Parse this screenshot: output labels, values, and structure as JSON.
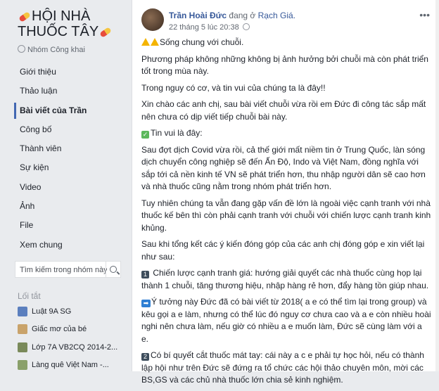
{
  "group": {
    "title": "HỘI NHÀ THUỐC TÂY",
    "privacy": "Nhóm Công khai"
  },
  "nav": [
    {
      "label": "Giới thiệu"
    },
    {
      "label": "Thảo luận"
    },
    {
      "label": "Bài viết của Trần"
    },
    {
      "label": "Công bố"
    },
    {
      "label": "Thành viên"
    },
    {
      "label": "Sự kiện"
    },
    {
      "label": "Video"
    },
    {
      "label": "Ảnh"
    },
    {
      "label": "File"
    },
    {
      "label": "Xem chung"
    }
  ],
  "search": {
    "placeholder": "Tìm kiếm trong nhóm này"
  },
  "shortcuts": {
    "title": "Lối tắt",
    "items": [
      {
        "label": "Luật 9A SG",
        "color": "#5b7fbe"
      },
      {
        "label": "Giấc mơ của bé",
        "color": "#c9a36b"
      },
      {
        "label": "Lớp 7A VB2CQ 2014-2...",
        "color": "#7a8a5a"
      },
      {
        "label": "Làng quê Việt Nam -...",
        "color": "#8aa06a"
      }
    ]
  },
  "post": {
    "author": "Trần Hoài Đức",
    "location_prefix": "đang ở",
    "location": "Rạch Giá.",
    "time": "22 tháng 5 lúc 20:38",
    "more": "•••",
    "p1": "Sống chung với chuỗi.",
    "p2": "Phương pháp không những không bị ảnh hưởng bởi chuỗi mà còn phát triển tốt trong mùa này.",
    "p3": "Trong nguy có cơ, và tin vui của chúng ta là đây!!",
    "p4": "Xin chào các anh chị, sau bài viết chuỗi vừa rồi em Đức đi công tác sắp mất nên chưa có dịp viết tiếp chuỗi bài này.",
    "p5": "Tin vui là đây:",
    "p6": "Sau đợt dịch Covid vừa rồi, cả thế giới mất niềm tin ở Trung Quốc, làn sóng dịch chuyển công nghiệp sẽ đến Ấn Độ, Indo và Việt Nam, đồng nghĩa với sắp tới cả nền kinh tế VN sẽ phát triển hơn, thu nhập người dân sẽ cao hơn và nhà thuốc cũng nằm trong nhóm phát triển hơn.",
    "p7": "Tuy nhiên chúng ta vẫn đang gặp vấn đề lớn là ngoài việc cạnh tranh với nhà thuốc kế bên thì còn phải cạnh tranh với chuỗi với chiến lược cạnh tranh kinh khủng.",
    "p8": "Sau khi tổng kết các ý kiến đóng góp của các anh chị đóng góp e xin viết lại như sau:",
    "n1": "1",
    "p9": "Chiến lược cạnh tranh giá: hướng giải quyết các nhà thuốc cùng họp lại thành 1 chuỗi, tăng thương hiệu, nhập hàng rẻ hơn, đẩy hàng tồn giúp nhau.",
    "arrow": "➡",
    "p10": "Ý tưởng này Đức đã có bài viết từ 2018( a e có thể tìm lại trong group) và kêu gọi a e làm, nhưng có thể lúc đó nguy cơ chưa cao và a e còn nhiều hoài nghi nên chưa làm, nếu giờ có nhiều a e muốn làm, Đức sẽ cùng làm với a e.",
    "n2": "2",
    "p11": "Có bí quyết cắt thuốc mát tay: cái này a c e phải tự học hỏi, nếu có thành lập hội như trên Đức sẽ đứng ra tổ chức các hội thảo chuyên môn, mời các BS,GS và các chủ nhà thuốc lớn chia sẻ kinh nghiệm."
  }
}
